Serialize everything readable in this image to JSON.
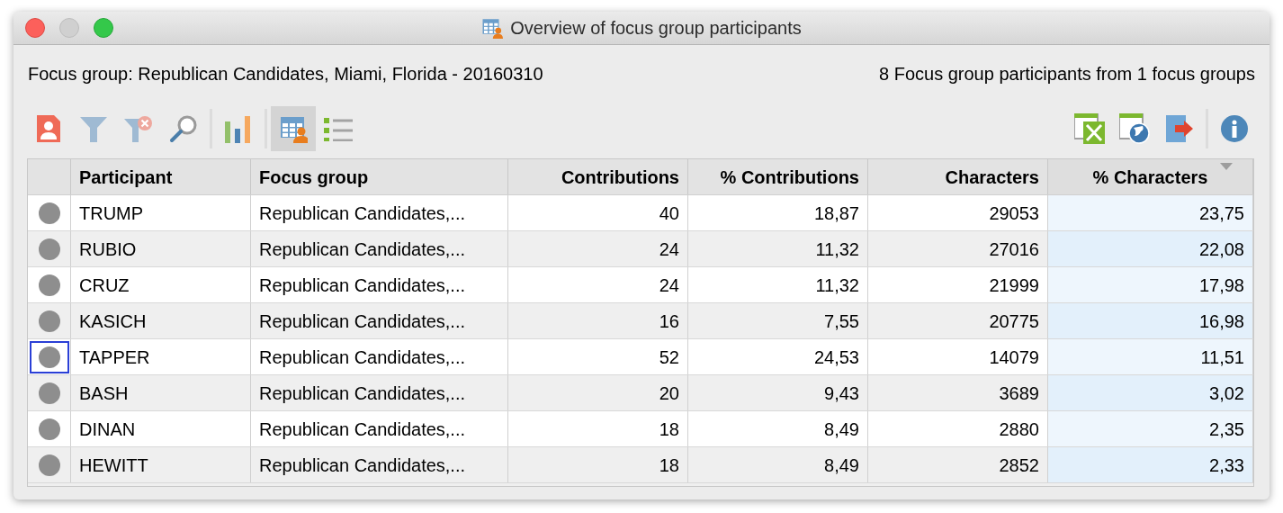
{
  "window": {
    "title": "Overview of focus group participants"
  },
  "info": {
    "focus_group": "Focus group: Republican Candidates, Miami, Florida - 20160310",
    "summary": "8 Focus group participants from 1 focus groups"
  },
  "toolbar": {
    "views": [
      {
        "selected": true
      },
      {
        "selected": false
      }
    ]
  },
  "table": {
    "columns": [
      {
        "label": "Participant",
        "sorted": false
      },
      {
        "label": "Focus group",
        "sorted": false
      },
      {
        "label": "Contributions",
        "sorted": false
      },
      {
        "label": "% Contributions",
        "sorted": false
      },
      {
        "label": "Characters",
        "sorted": false
      },
      {
        "label": "% Characters",
        "sorted": true
      }
    ],
    "rows": [
      {
        "focused": false,
        "cells": [
          "TRUMP",
          "Republican Candidates,...",
          "40",
          "18,87",
          "29053",
          "23,75"
        ]
      },
      {
        "focused": false,
        "cells": [
          "RUBIO",
          "Republican Candidates,...",
          "24",
          "11,32",
          "27016",
          "22,08"
        ]
      },
      {
        "focused": false,
        "cells": [
          "CRUZ",
          "Republican Candidates,...",
          "24",
          "11,32",
          "21999",
          "17,98"
        ]
      },
      {
        "focused": false,
        "cells": [
          "KASICH",
          "Republican Candidates,...",
          "16",
          "7,55",
          "20775",
          "16,98"
        ]
      },
      {
        "focused": true,
        "cells": [
          "TAPPER",
          "Republican Candidates,...",
          "52",
          "24,53",
          "14079",
          "11,51"
        ]
      },
      {
        "focused": false,
        "cells": [
          "BASH",
          "Republican Candidates,...",
          "20",
          "9,43",
          "3689",
          "3,02"
        ]
      },
      {
        "focused": false,
        "cells": [
          "DINAN",
          "Republican Candidates,...",
          "18",
          "8,49",
          "2880",
          "2,35"
        ]
      },
      {
        "focused": false,
        "cells": [
          "HEWITT",
          "Republican Candidates,...",
          "18",
          "8,49",
          "2852",
          "2,33"
        ]
      }
    ]
  }
}
